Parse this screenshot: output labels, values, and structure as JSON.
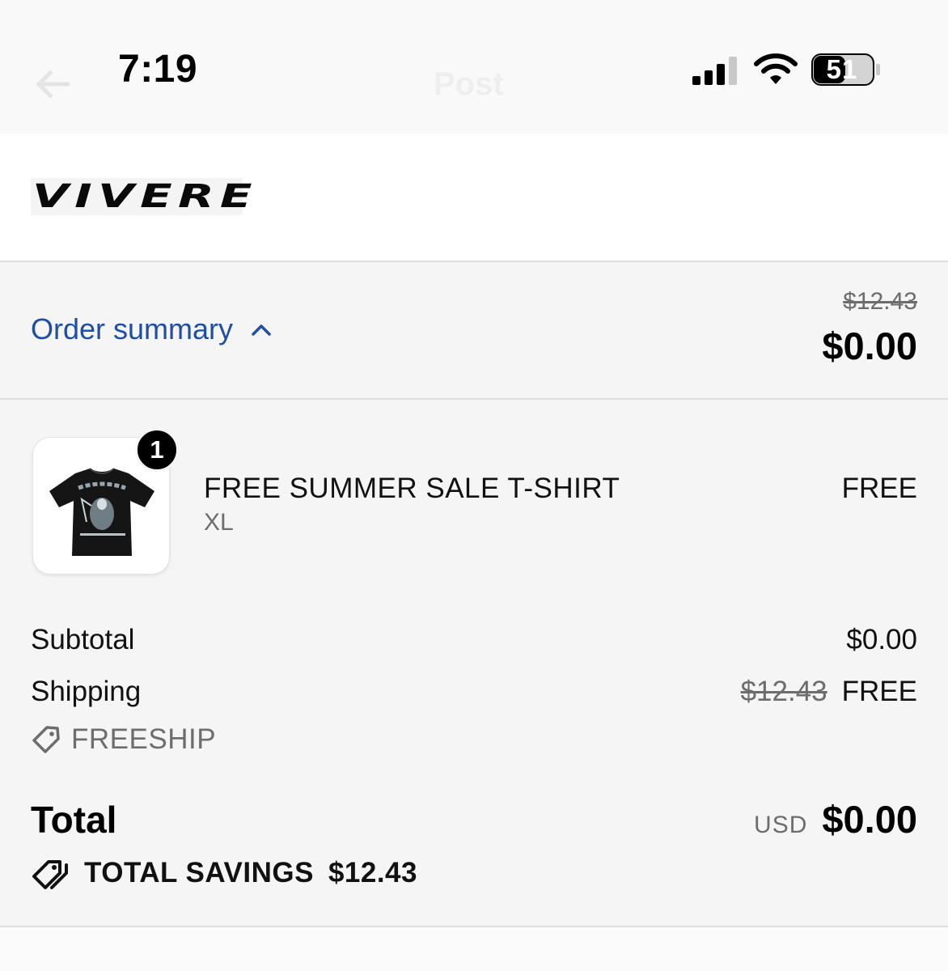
{
  "status_bar": {
    "time": "7:19",
    "battery_level": "51",
    "ghost_title": "Post",
    "icons": [
      "back-arrow-icon",
      "cellular-signal-icon",
      "wifi-icon",
      "battery-icon"
    ]
  },
  "brand": {
    "logo_text": "VIVERE"
  },
  "summary": {
    "label": "Order summary",
    "original_price": "$12.43",
    "total": "$0.00",
    "link_color": "#1f4ea3"
  },
  "line_items": [
    {
      "quantity": "1",
      "name": "FREE SUMMER SALE T-SHIRT",
      "variant": "XL",
      "price": "FREE",
      "image": "black-tshirt-graphic"
    }
  ],
  "costs": {
    "subtotal_label": "Subtotal",
    "subtotal_value": "$0.00",
    "shipping_label": "Shipping",
    "shipping_original": "$12.43",
    "shipping_value": "FREE",
    "discount_code": "FREESHIP"
  },
  "total": {
    "label": "Total",
    "currency": "USD",
    "amount": "$0.00"
  },
  "savings": {
    "label": "TOTAL SAVINGS",
    "amount": "$12.43"
  }
}
